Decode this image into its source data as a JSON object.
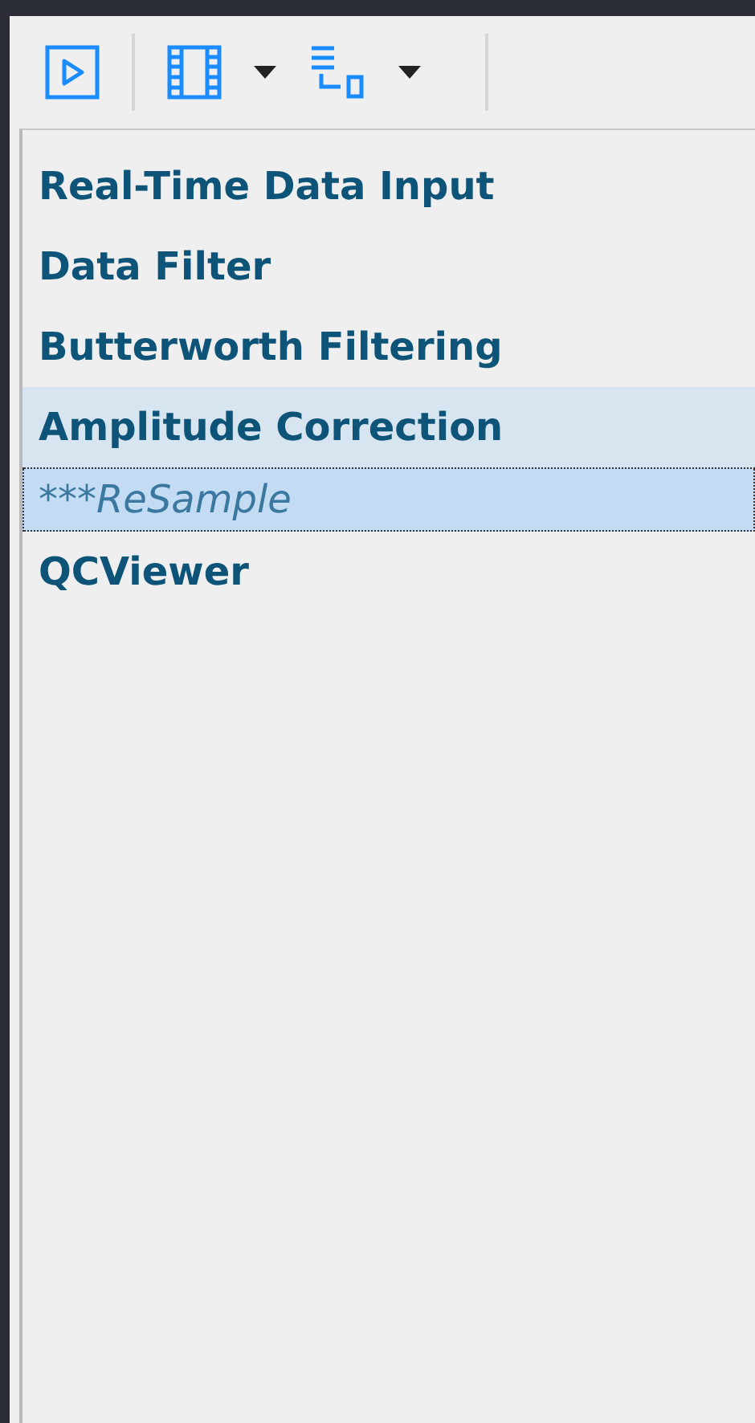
{
  "toolbar": {
    "buttons": [
      {
        "kind": "play"
      },
      {
        "kind": "film",
        "dropdown": true
      },
      {
        "kind": "layout",
        "dropdown": true
      }
    ]
  },
  "list": {
    "items": [
      {
        "label": "Real-Time Data Input",
        "kind": "module",
        "hovered": false,
        "selected": false
      },
      {
        "label": "Data Filter",
        "kind": "module",
        "hovered": false,
        "selected": false
      },
      {
        "label": "Butterworth Filtering",
        "kind": "module",
        "hovered": false,
        "selected": false
      },
      {
        "label": "Amplitude Correction",
        "kind": "module",
        "hovered": true,
        "selected": false
      },
      {
        "label": "***ReSample",
        "kind": "placeholder",
        "hovered": false,
        "selected": true
      },
      {
        "label": "QCViewer",
        "kind": "module",
        "hovered": false,
        "selected": false
      }
    ]
  }
}
